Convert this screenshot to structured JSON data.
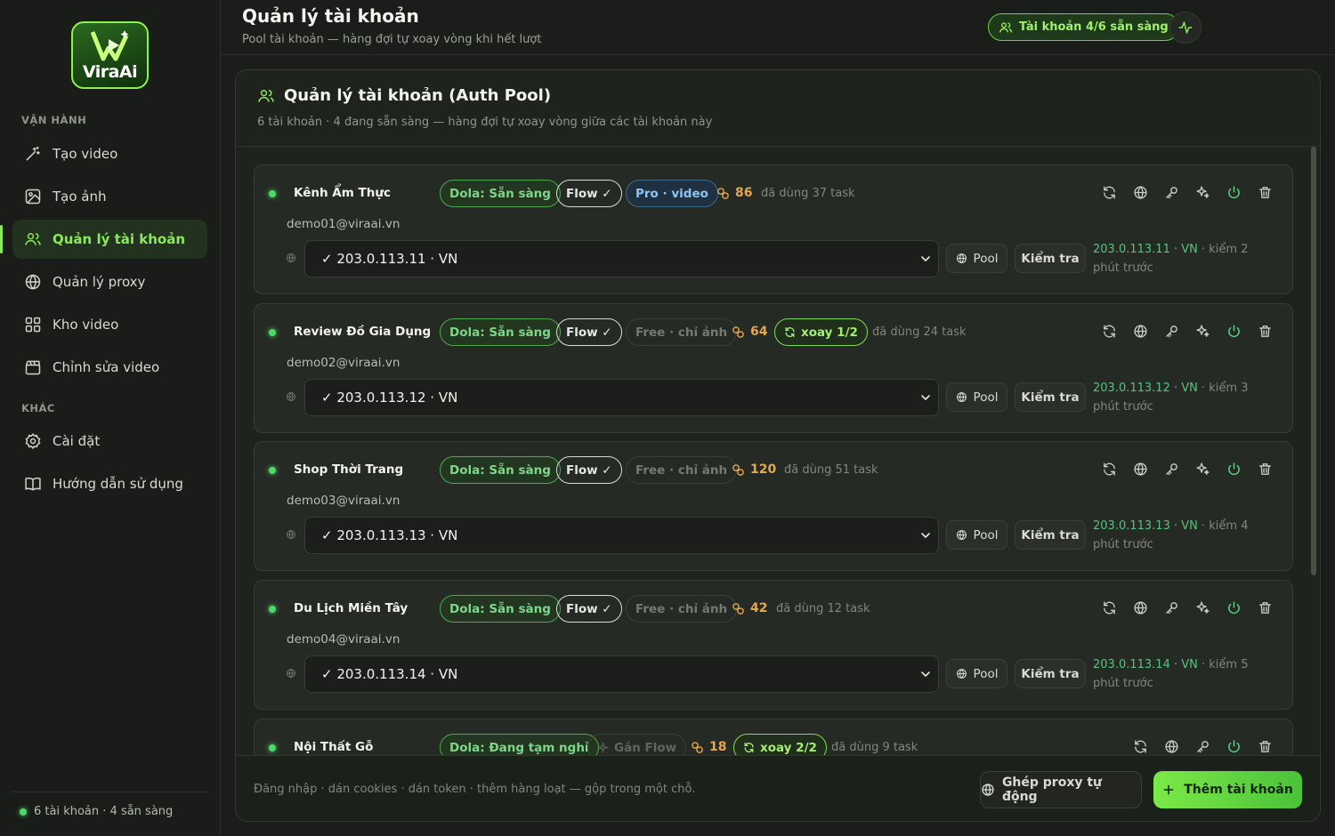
{
  "app": {
    "logo_text": "ViraAi"
  },
  "sidebar": {
    "section_ops": "VẬN HÀNH",
    "section_other": "KHÁC",
    "items": [
      {
        "label": "Tạo video",
        "icon": "wand-icon"
      },
      {
        "label": "Tạo ảnh",
        "icon": "image-icon"
      },
      {
        "label": "Quản lý tài khoản",
        "icon": "users-icon",
        "active": true
      },
      {
        "label": "Quản lý proxy",
        "icon": "globe-icon"
      },
      {
        "label": "Kho video",
        "icon": "grid-icon"
      },
      {
        "label": "Chỉnh sửa video",
        "icon": "clapper-icon"
      }
    ],
    "other_items": [
      {
        "label": "Cài đặt",
        "icon": "gear-icon"
      },
      {
        "label": "Hướng dẫn sử dụng",
        "icon": "book-icon"
      }
    ],
    "footer": "6 tài khoản · 4 sẵn sàng"
  },
  "header": {
    "title": "Quản lý tài khoản",
    "subtitle": "Pool tài khoản — hàng đợi tự xoay vòng khi hết lượt",
    "status_pill": "Tài khoản 4/6 sẵn sàng"
  },
  "panel": {
    "title": "Quản lý tài khoản (Auth Pool)",
    "subtitle": "6 tài khoản · 4 đang sẵn sàng — hàng đợi tự xoay vòng giữa các tài khoản này",
    "pool_label": "Pool",
    "check_label": "Kiểm tra",
    "accounts": [
      {
        "name": "Kênh Ẩm Thực",
        "dola": "Dola: Sẵn sàng",
        "flow": "Flow ✓",
        "plan": "Pro · video",
        "credits": "86",
        "rotate": "",
        "used": "đã dùng 37 task",
        "email": "demo01@viraai.vn",
        "proxy": "✓ 203.0.113.11 · VN",
        "ip": "203.0.113.11 · VN",
        "checked": "· kiểm 2 phút trước"
      },
      {
        "name": "Review Đồ Gia Dụng",
        "dola": "Dola: Sẵn sàng",
        "flow": "Flow ✓",
        "plan": "Free · chỉ ảnh",
        "credits": "64",
        "rotate": "xoay 1/2",
        "used": "đã dùng 24 task",
        "email": "demo02@viraai.vn",
        "proxy": "✓ 203.0.113.12 · VN",
        "ip": "203.0.113.12 · VN",
        "checked": "· kiểm 3 phút trước"
      },
      {
        "name": "Shop Thời Trang",
        "dola": "Dola: Sẵn sàng",
        "flow": "Flow ✓",
        "plan": "Free · chỉ ảnh",
        "credits": "120",
        "rotate": "",
        "used": "đã dùng 51 task",
        "email": "demo03@viraai.vn",
        "proxy": "✓ 203.0.113.13 · VN",
        "ip": "203.0.113.13 · VN",
        "checked": "· kiểm 4 phút trước"
      },
      {
        "name": "Du Lịch Miền Tây",
        "dola": "Dola: Sẵn sàng",
        "flow": "Flow ✓",
        "plan": "Free · chỉ ảnh",
        "credits": "42",
        "rotate": "",
        "used": "đã dùng 12 task",
        "email": "demo04@viraai.vn",
        "proxy": "✓ 203.0.113.14 · VN",
        "ip": "203.0.113.14 · VN",
        "checked": "· kiểm 5 phút trước"
      },
      {
        "name": "Nội Thất Gỗ",
        "dola": "Dola: Đang tạm nghỉ",
        "flow": "Gắn Flow",
        "plan": "",
        "credits": "18",
        "rotate": "xoay 2/2",
        "used": "đã dùng 9 task",
        "email": "",
        "proxy": "",
        "ip": "",
        "checked": ""
      }
    ]
  },
  "footer": {
    "text": "Đăng nhập · dán cookies · dán token · thêm hàng loạt — gộp trong một chỗ.",
    "proxy_button": "Ghép proxy tự động",
    "add_button": "Thêm tài khoản"
  },
  "colors": {
    "accent": "#8ae85b",
    "ready": "#4cd964",
    "credits": "#e3a84f",
    "pro": "#8cc4f2"
  }
}
